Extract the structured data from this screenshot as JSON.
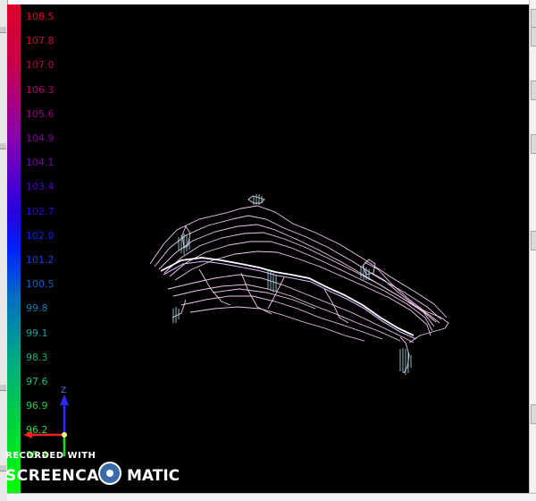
{
  "legend": {
    "ticks": [
      {
        "label": "108.5",
        "color": "#e0002a"
      },
      {
        "label": "107.8",
        "color": "#d0003c"
      },
      {
        "label": "107.0",
        "color": "#c00050"
      },
      {
        "label": "106.3",
        "color": "#b0006a"
      },
      {
        "label": "105.6",
        "color": "#a00088"
      },
      {
        "label": "104.9",
        "color": "#8c00a0"
      },
      {
        "label": "104.1",
        "color": "#7000b8"
      },
      {
        "label": "103.4",
        "color": "#5000d0"
      },
      {
        "label": "102.7",
        "color": "#3000e8"
      },
      {
        "label": "102.0",
        "color": "#1020ff"
      },
      {
        "label": "101.2",
        "color": "#1040e8"
      },
      {
        "label": "100.5",
        "color": "#1060d0"
      },
      {
        "label": "99.8",
        "color": "#1080b0"
      },
      {
        "label": "99.1",
        "color": "#10a098"
      },
      {
        "label": "98.3",
        "color": "#10b080"
      },
      {
        "label": "97.6",
        "color": "#10c068"
      },
      {
        "label": "96.9",
        "color": "#10d050"
      },
      {
        "label": "96.2",
        "color": "#10e038"
      },
      {
        "label": "95.4",
        "color": "#20f020"
      }
    ]
  },
  "axes": {
    "z_label": "Z"
  },
  "watermark": {
    "line1": "RECORDED WITH",
    "line2": "SCREENCAST",
    "line3": "MATIC"
  },
  "colors": {
    "background": "#000000",
    "contour": "#f0c8f0"
  }
}
